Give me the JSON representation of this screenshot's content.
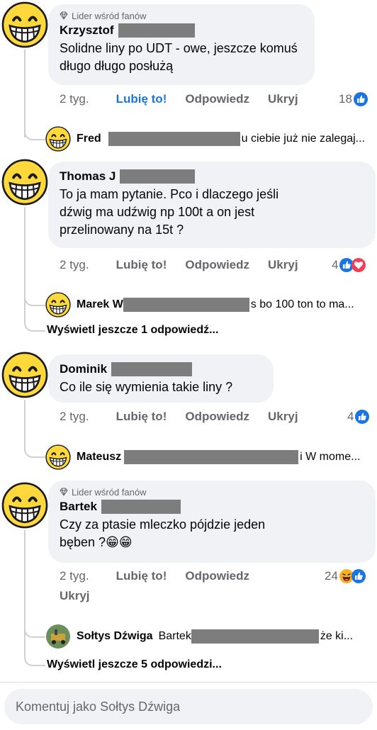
{
  "comments": [
    {
      "badge": "Lider wśród fanów",
      "author": "Krzysztof",
      "text_lines": [
        "Solidne liny po UDT - owe, jeszcze komuś",
        "długo długo posłużą"
      ],
      "time": "2 tyg.",
      "like": "Lubię to!",
      "reply": "Odpowiedz",
      "hide": "Ukryj",
      "reaction_count": "18",
      "reactions": [
        "like-icon"
      ],
      "replies": [
        {
          "author": "Fred",
          "snippet": "u ciebie już nie zalegaj..."
        }
      ]
    },
    {
      "author": "Thomas J",
      "text_lines": [
        "To ja mam pytanie. Pco i dlaczego jeśli",
        "dźwig ma udźwig  np 100t a on jest",
        "przelinowany na 15t ?"
      ],
      "time": "2 tyg.",
      "like": "Lubię to!",
      "reply": "Odpowiedz",
      "hide": "Ukryj",
      "reaction_count": "4",
      "reactions": [
        "like-icon",
        "love-icon"
      ],
      "replies": [
        {
          "author": "Marek W",
          "snippet": "s bo 100 ton to ma..."
        }
      ],
      "more": "Wyświetl jeszcze 1 odpowiedź..."
    },
    {
      "author": "Dominik",
      "text_lines": [
        "Co ile się wymienia takie liny ?"
      ],
      "time": "2 tyg.",
      "like": "Lubię to!",
      "reply": "Odpowiedz",
      "hide": "Ukryj",
      "reaction_count": "4",
      "reactions": [
        "like-icon"
      ],
      "replies": [
        {
          "author": "Mateusz",
          "snippet": "i W mome..."
        }
      ]
    },
    {
      "badge": "Lider wśród fanów",
      "author": "Bartek",
      "text_lines": [
        "Czy za ptasie mleczko pójdzie jeden",
        "bęben  ?😁😁"
      ],
      "time": "2 tyg.",
      "like": "Lubię to!",
      "reply": "Odpowiedz",
      "hide": "Ukryj",
      "reaction_count": "24",
      "reactions": [
        "haha-icon",
        "like-icon"
      ],
      "replies": [
        {
          "author": "Sołtys Dźwiga",
          "prefix": "Bartek",
          "snippet": "że ki..."
        }
      ],
      "more": "Wyświetl jeszcze 5 odpowiedzi..."
    }
  ],
  "composer": {
    "placeholder": "Komentuj jako Sołtys Dźwiga"
  },
  "colors": {
    "accent": "#1b74e4",
    "bubble": "#f0f2f5",
    "secondary_text": "#65676b",
    "love": "#f33e58",
    "haha": "#f7b125"
  }
}
